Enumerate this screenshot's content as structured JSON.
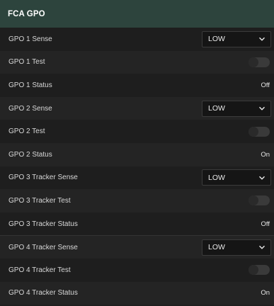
{
  "panel": {
    "title": "FCA GPO"
  },
  "rows": [
    {
      "label": "GPO 1 Sense",
      "type": "select",
      "value": "LOW"
    },
    {
      "label": "GPO 1 Test",
      "type": "toggle",
      "checked": false
    },
    {
      "label": "GPO 1 Status",
      "type": "status",
      "value": "Off"
    },
    {
      "label": "GPO 2 Sense",
      "type": "select",
      "value": "LOW"
    },
    {
      "label": "GPO 2 Test",
      "type": "toggle",
      "checked": false
    },
    {
      "label": "GPO 2 Status",
      "type": "status",
      "value": "On"
    },
    {
      "label": "GPO 3 Tracker Sense",
      "type": "select",
      "value": "LOW"
    },
    {
      "label": "GPO 3 Tracker Test",
      "type": "toggle",
      "checked": false
    },
    {
      "label": "GPO 3 Tracker Status",
      "type": "status",
      "value": "Off"
    },
    {
      "label": "GPO 4 Tracker Sense",
      "type": "select",
      "value": "LOW"
    },
    {
      "label": "GPO 4 Tracker Test",
      "type": "toggle",
      "checked": false
    },
    {
      "label": "GPO 4 Tracker Status",
      "type": "status",
      "value": "On"
    }
  ]
}
